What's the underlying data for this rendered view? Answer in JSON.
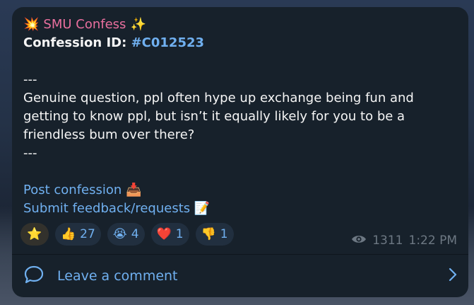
{
  "post": {
    "channel_name": "SMU Confess",
    "channel_prefix_emoji": "💥",
    "channel_suffix_emoji": "✨",
    "confession_label": "Confession ID:",
    "confession_id": "#C012523",
    "sep_top": "---",
    "body_lines": [
      "Genuine question, ppl often hype up exchange being fun and",
      "getting to know ppl, but isn’t it equally likely for you to be a",
      "friendless bum over there?"
    ],
    "sep_bottom": "---",
    "link_post": "Post confession",
    "link_post_emoji": "📥",
    "link_feedback": "Submit feedback/requests",
    "link_feedback_emoji": "📝"
  },
  "reactions": [
    {
      "emoji": "⭐",
      "count": ""
    },
    {
      "emoji": "👍",
      "count": "27"
    },
    {
      "emoji": "😭",
      "count": "4"
    },
    {
      "emoji": "❤️",
      "count": "1"
    },
    {
      "emoji": "👎",
      "count": "1"
    }
  ],
  "meta": {
    "views": "1311",
    "time": "1:22 PM"
  },
  "footer": {
    "label": "Leave a comment"
  }
}
